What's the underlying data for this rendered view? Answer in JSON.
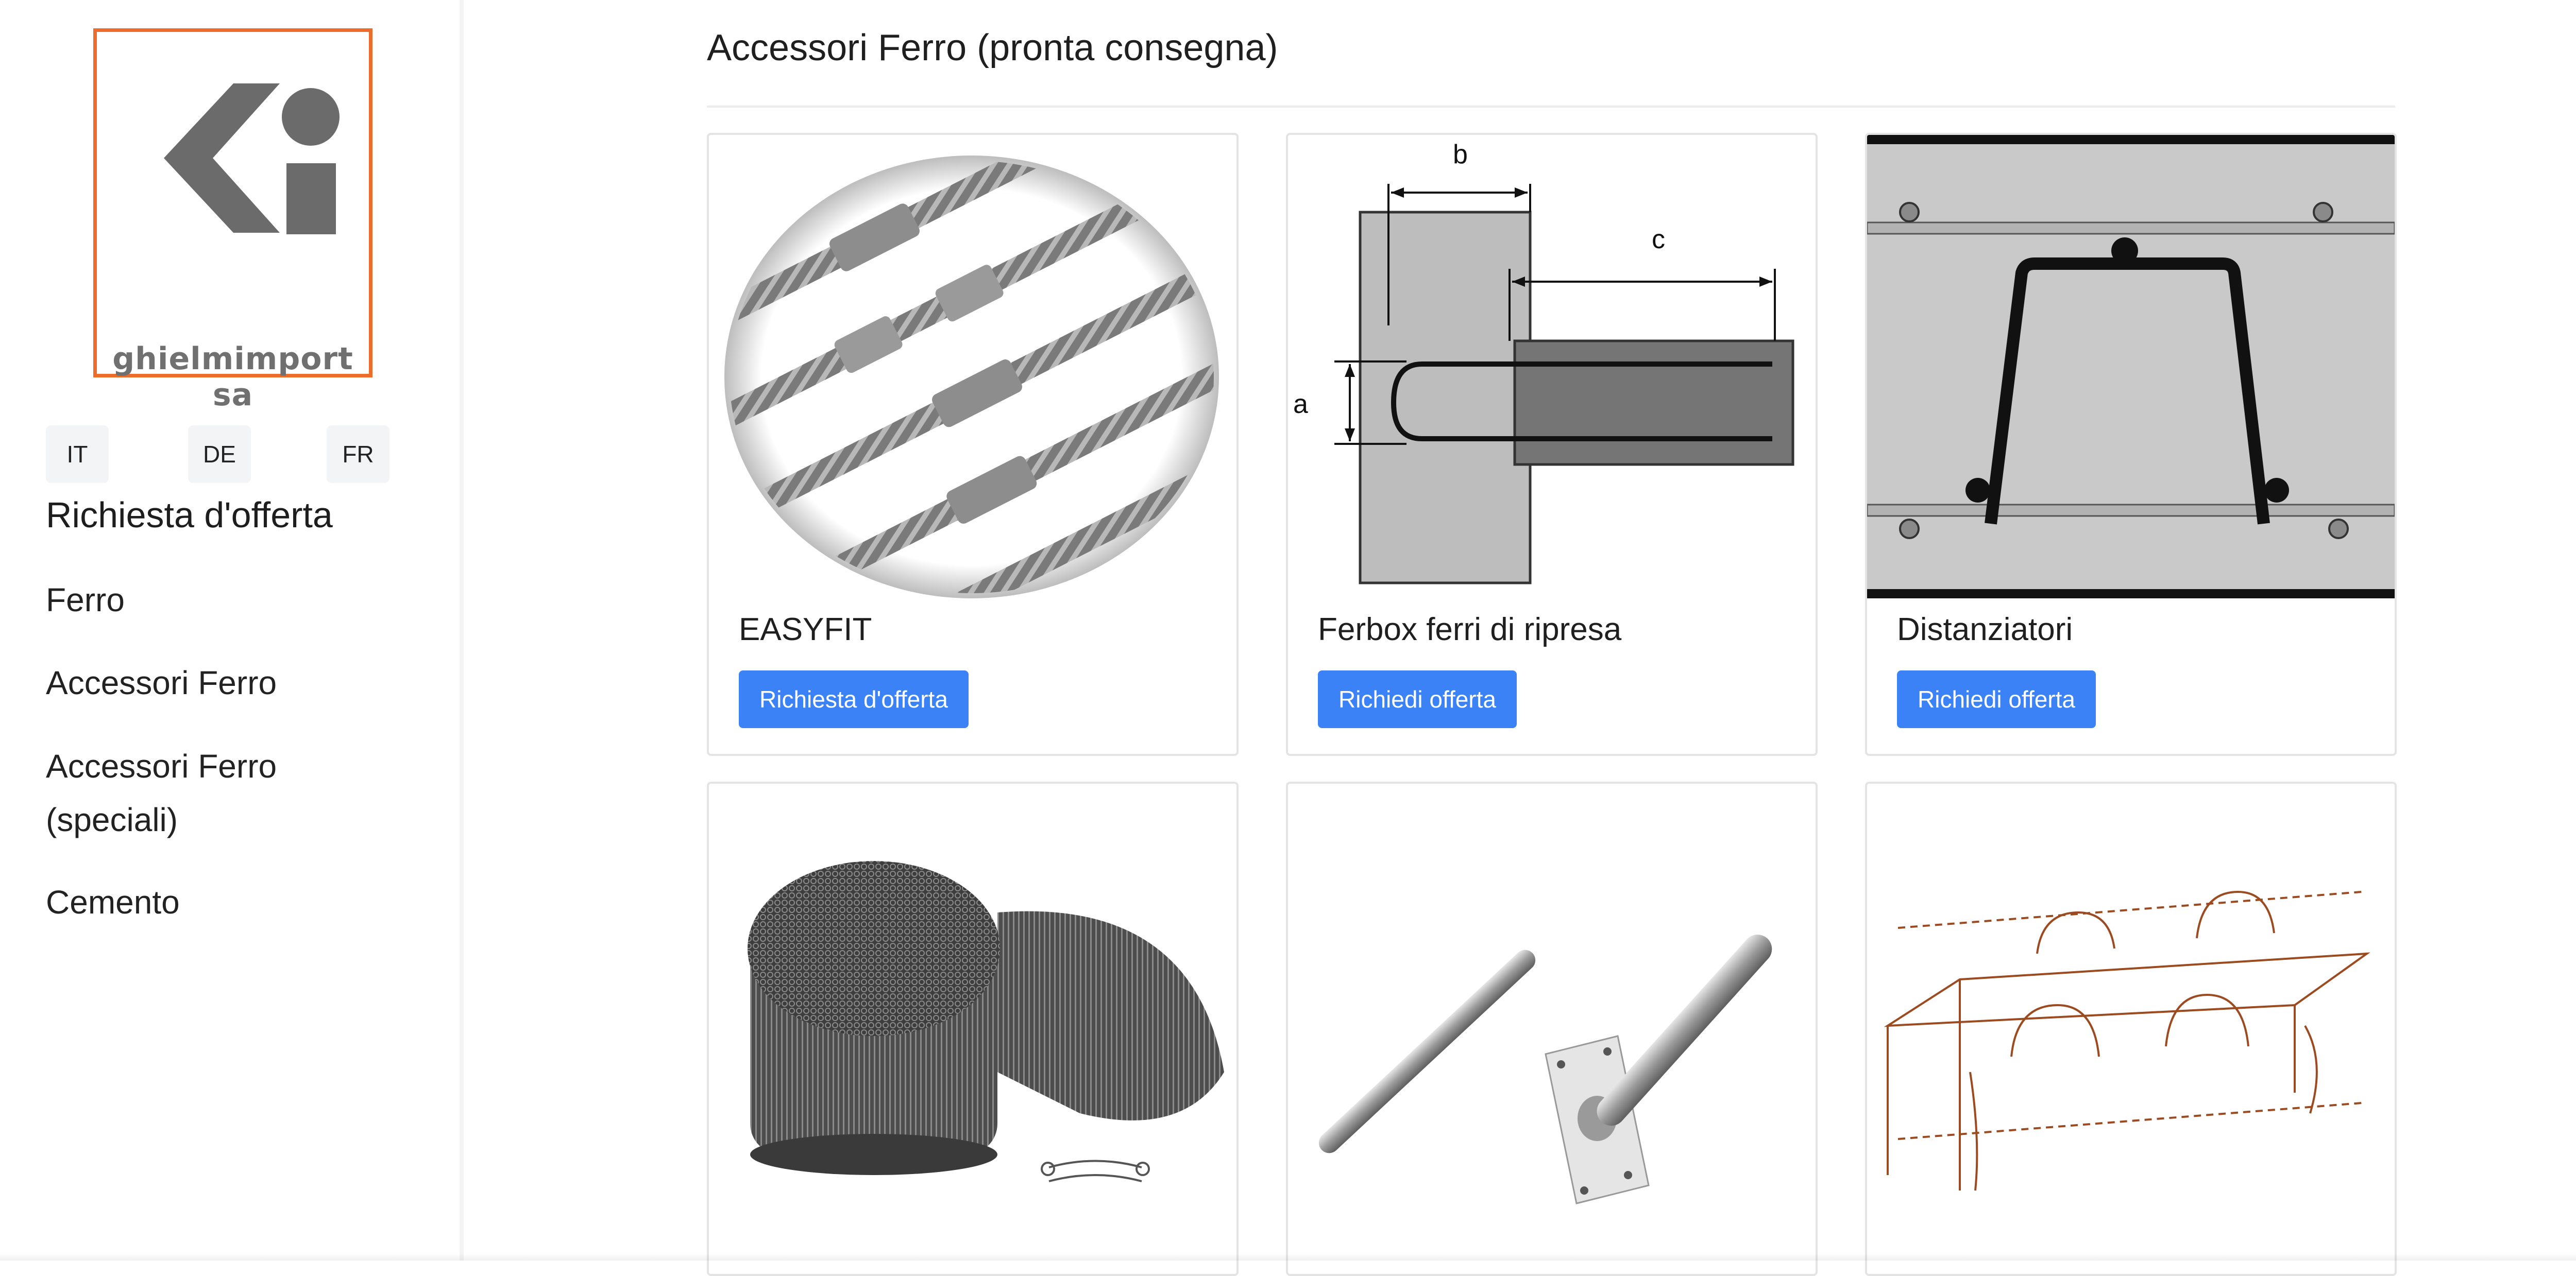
{
  "brand": {
    "logo_text": "ghielmimport sa",
    "accent_color": "#ec6c2b"
  },
  "languages": [
    "IT",
    "DE",
    "FR"
  ],
  "sidebar": {
    "title": "Richiesta d'offerta",
    "items": [
      {
        "label": "Ferro"
      },
      {
        "label": "Accessori Ferro"
      },
      {
        "label": "Accessori Ferro (speciali)"
      },
      {
        "label": "Cemento"
      }
    ]
  },
  "main": {
    "title": "Accessori Ferro (pronta consegna)",
    "button_color": "#3b82f6",
    "cards": [
      {
        "title": "EASYFIT",
        "button": "Richiesta d'offerta",
        "image": "rebar-couplers-photo"
      },
      {
        "title": "Ferbox ferri di ripresa",
        "button": "Richiedi offerta",
        "image": "ferbox-diagram",
        "diagram_labels": [
          "b",
          "c",
          "a"
        ]
      },
      {
        "title": "Distanziatori",
        "button": "Richiedi offerta",
        "image": "spacer-diagram"
      },
      {
        "image": "tie-wire-coil-photo"
      },
      {
        "image": "dowel-bars-photo"
      },
      {
        "image": "formwork-sketch"
      }
    ]
  }
}
